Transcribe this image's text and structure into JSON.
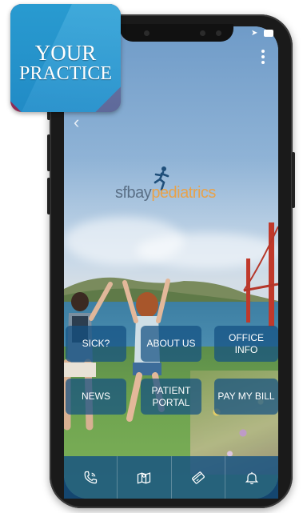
{
  "badge": {
    "line1": "YOUR",
    "line2": "PRACTICE"
  },
  "header": {
    "back_icon": "chevron-left-icon",
    "menu_icon": "kebab-menu-icon"
  },
  "logo": {
    "part1": "sfbay",
    "part2": "pediatrics"
  },
  "tiles": [
    {
      "label": "SICK?"
    },
    {
      "label": "ABOUT US"
    },
    {
      "label": "OFFICE INFO"
    },
    {
      "label": "NEWS"
    },
    {
      "label": "PATIENT PORTAL"
    },
    {
      "label": "PAY MY BILL"
    }
  ],
  "tabbar": {
    "items": [
      {
        "icon": "phone-icon"
      },
      {
        "icon": "map-icon"
      },
      {
        "icon": "payment-card-icon"
      },
      {
        "icon": "bell-icon"
      }
    ]
  },
  "colors": {
    "tile_bg": "#145082",
    "badge_magenta": "#8e2c55",
    "badge_blue": "#2ea6d8",
    "logo_orange": "#e8a24a"
  }
}
